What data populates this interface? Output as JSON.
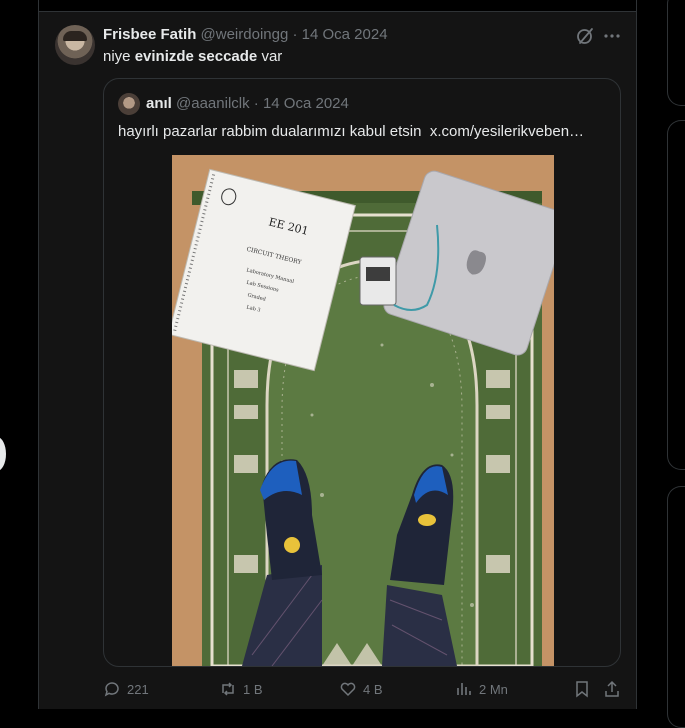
{
  "tweet": {
    "author_name": "Frisbee Fatih",
    "author_handle": "@weirdoingg",
    "sep": "·",
    "date": "14 Oca 2024",
    "text_before": "niye",
    "text_bold": "evinizde seccade",
    "text_after": "var",
    "icons": {
      "grok": "grok-icon",
      "more": "more-icon"
    }
  },
  "quote": {
    "author_name": "anıl",
    "author_handle": "@aaanilclk",
    "sep": "·",
    "date": "14 Oca 2024",
    "text": "hayırlı pazarlar rabbim dualarımızı kabul etsin",
    "link": "x.com/yesilerikveben…"
  },
  "actions": {
    "reply_count": "221",
    "retweet_count": "1 B",
    "like_count": "4 B",
    "views_count": "2 Mn"
  },
  "photo_notebook": {
    "course": "EE 201",
    "subtitle": "CIRCUIT THEORY",
    "lines": [
      "Laboratory Manual",
      "Lab Sessions",
      "Graded",
      "Lab 3"
    ]
  },
  "colors": {
    "background": "#000000",
    "tweet_bg": "#141414",
    "text": "#e7e9ea",
    "muted": "#71767b",
    "border": "#2f3336"
  }
}
